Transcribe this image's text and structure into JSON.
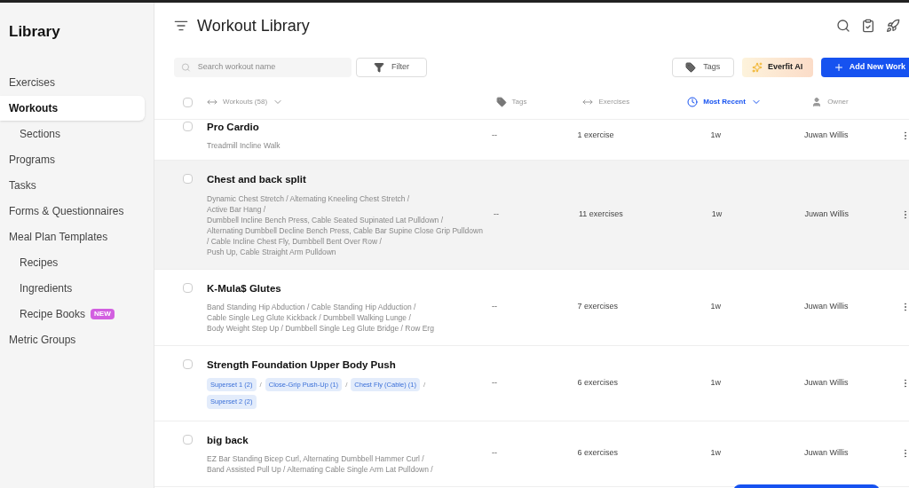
{
  "sidebar": {
    "title": "Library",
    "items": [
      {
        "label": "Exercises",
        "selected": false
      },
      {
        "label": "Workouts",
        "selected": true,
        "children": [
          {
            "label": "Sections",
            "selected": false
          }
        ]
      },
      {
        "label": "Programs",
        "selected": false
      },
      {
        "label": "Tasks",
        "selected": false
      },
      {
        "label": "Forms & Questionnaires",
        "selected": false
      },
      {
        "label": "Meal Plan Templates",
        "selected": false,
        "children": [
          {
            "label": "Recipes",
            "selected": false
          },
          {
            "label": "Ingredients",
            "selected": false
          },
          {
            "label": "Recipe Books",
            "selected": false,
            "badge": "NEW"
          }
        ]
      },
      {
        "label": "Metric Groups",
        "selected": false
      }
    ]
  },
  "header": {
    "title": "Workout Library"
  },
  "toolbar": {
    "search": {
      "placeholder": "Search workout name"
    },
    "filter": "Filter",
    "tags": "Tags",
    "ai": "Everfit AI",
    "add": "Add New Work"
  },
  "table": {
    "select_all_checked": false,
    "columns": [
      {
        "label": "Workouts (58)",
        "kind": "sortable",
        "active": false
      },
      {
        "label": "Tags",
        "kind": "tag",
        "active": false
      },
      {
        "label": "Exercises",
        "kind": "sortable",
        "active": false
      },
      {
        "label": "Most Recent",
        "kind": "clock",
        "active": true
      },
      {
        "label": "Owner",
        "kind": "person",
        "active": false
      }
    ],
    "rows": [
      {
        "name": "Pro Cardio",
        "kind": "text",
        "lines": [
          "Treadmill Incline Walk"
        ],
        "tags": "--",
        "exercises": "1 exercise",
        "recent": "1w",
        "owner": "Juwan Willis",
        "checked": false,
        "highlighted": false
      },
      {
        "name": "Chest and back split",
        "kind": "text",
        "lines": [
          "Dynamic Chest Stretch / Alternating Kneeling Chest Stretch /",
          "Active Bar Hang /",
          "Dumbbell Incline Bench Press, Cable Seated Supinated Lat Pulldown /",
          "Alternating Dumbbell Decline Bench Press, Cable Bar Supine Close Grip Pulldown",
          "/ Cable Incline Chest Fly, Dumbbell Bent Over Row /",
          "Push Up, Cable Straight Arm Pulldown"
        ],
        "tags": "--",
        "exercises": "11 exercises",
        "recent": "1w",
        "owner": "Juwan Willis",
        "checked": false,
        "highlighted": true
      },
      {
        "name": "K-Mula$ Glutes",
        "kind": "text",
        "lines": [
          "Band Standing Hip Abduction / Cable Standing Hip Adduction /",
          "Cable Single Leg Glute Kickback / Dumbbell Walking Lunge /",
          "Body Weight Step Up / Dumbbell Single Leg Glute Bridge / Row Erg"
        ],
        "tags": "--",
        "exercises": "7 exercises",
        "recent": "1w",
        "owner": "Juwan Willis",
        "checked": false,
        "highlighted": false
      },
      {
        "name": "Strength Foundation Upper Body Push",
        "kind": "chips",
        "separator": "/",
        "chips": [
          "Superset 1 (2)",
          "Close-Grip Push-Up (1)",
          "Chest Fly (Cable) (1)",
          "Superset 2 (2)"
        ],
        "tags": "--",
        "exercises": "6 exercises",
        "recent": "1w",
        "owner": "Juwan Willis",
        "checked": false,
        "highlighted": false
      },
      {
        "name": "big back",
        "kind": "text",
        "lines": [
          "EZ Bar Standing Bicep Curl, Alternating Dumbbell Hammer Curl /",
          "Band Assisted Pull Up / Alternating Cable Single Arm Lat Pulldown /"
        ],
        "tags": "--",
        "exercises": "6 exercises",
        "recent": "1w",
        "owner": "Juwan Willis",
        "checked": false,
        "highlighted": false
      }
    ]
  }
}
